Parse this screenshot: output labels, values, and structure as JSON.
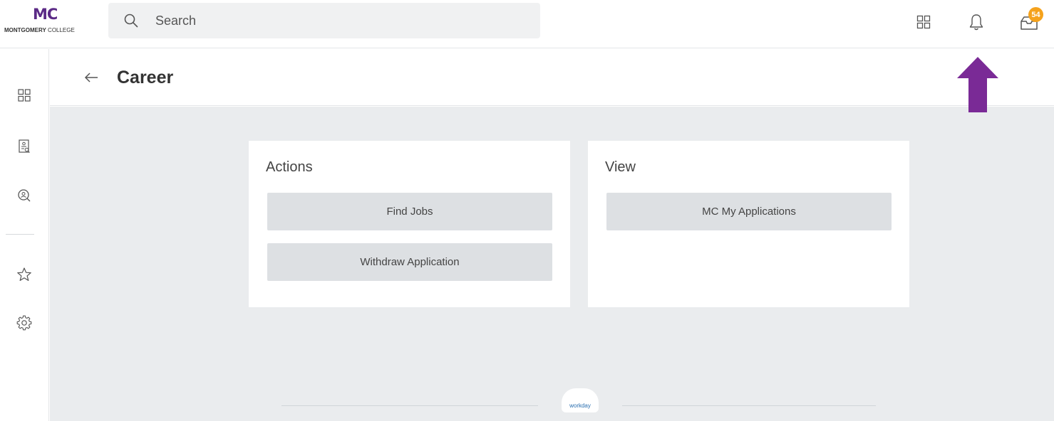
{
  "brand": {
    "mark": "MC",
    "name_bold": "MONTGOMERY",
    "name_rest": " COLLEGE"
  },
  "search": {
    "placeholder": "Search"
  },
  "header_icons": {
    "apps": "apps-grid-icon",
    "notifications": "bell-icon",
    "inbox": "inbox-icon",
    "inbox_badge": "54"
  },
  "sidebar": {
    "items": [
      {
        "icon": "dashboard-icon"
      },
      {
        "icon": "directory-icon"
      },
      {
        "icon": "profile-search-icon"
      },
      {
        "icon": "star-icon"
      },
      {
        "icon": "gear-icon"
      }
    ]
  },
  "page": {
    "title": "Career"
  },
  "cards": {
    "actions": {
      "title": "Actions",
      "buttons": [
        "Find Jobs",
        "Withdraw Application"
      ]
    },
    "view": {
      "title": "View",
      "buttons": [
        "MC My Applications"
      ]
    }
  },
  "footer": {
    "logo_text": "workday"
  },
  "colors": {
    "brand_purple": "#5b2a86",
    "badge_orange": "#f5a21c",
    "annotation_arrow": "#7a2a96",
    "content_bg": "#eaecee",
    "button_bg": "#dde0e3"
  }
}
